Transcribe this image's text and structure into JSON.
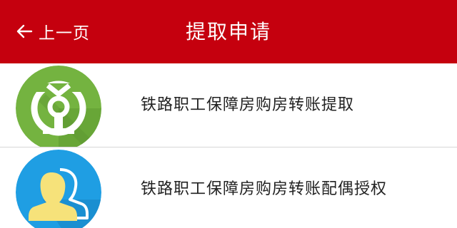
{
  "header": {
    "back_label": "上一页",
    "title": "提取申请",
    "background_color": "#c5000e"
  },
  "items": [
    {
      "label": "铁路职工保障房购房转账提取",
      "icon": "railway-logo-icon",
      "icon_color": "#74b340"
    },
    {
      "label": "铁路职工保障房购房转账配偶授权",
      "icon": "users-icon",
      "icon_color": "#1f9ee3"
    }
  ]
}
